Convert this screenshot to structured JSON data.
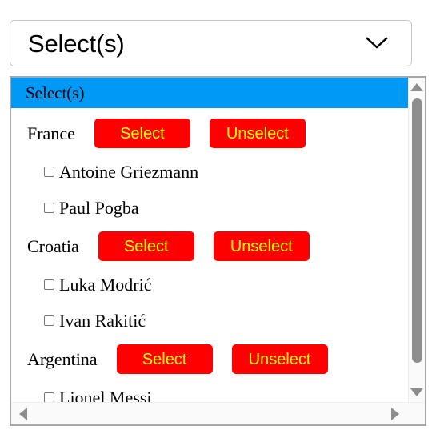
{
  "combobox": {
    "value": "Select(s)",
    "icon": "chevron-down-icon"
  },
  "panel": {
    "header_label": "Select(s)",
    "select_label": "Select",
    "unselect_label": "Unselect",
    "groups": [
      {
        "name": "France",
        "select_label": "Select",
        "unselect_label": "Unselect",
        "options": [
          {
            "label": "Antoine Griezmann",
            "checked": false
          },
          {
            "label": "Paul Pogba",
            "checked": false
          }
        ]
      },
      {
        "name": "Croatia",
        "select_label": "Select",
        "unselect_label": "Unselect",
        "options": [
          {
            "label": "Luka Modrić",
            "checked": false
          },
          {
            "label": "Ivan Rakitić",
            "checked": false
          }
        ]
      },
      {
        "name": "Argentina",
        "select_label": "Select",
        "unselect_label": "Unselect",
        "options": [
          {
            "label": "Lionel Messi",
            "checked": false
          }
        ]
      }
    ]
  },
  "colors": {
    "header_blue": "#0099f5",
    "button_red": "#ff0000",
    "button_text_yellow": "#ffff00",
    "scrollbar_gray": "#8d8d8d",
    "panel_border": "#a8a8a8"
  },
  "scrollbars": {
    "vertical": {
      "up_icon": "triangle-up-icon",
      "down_icon": "triangle-down-icon"
    },
    "horizontal": {
      "left_icon": "triangle-left-icon",
      "right_icon": "triangle-right-icon"
    }
  }
}
